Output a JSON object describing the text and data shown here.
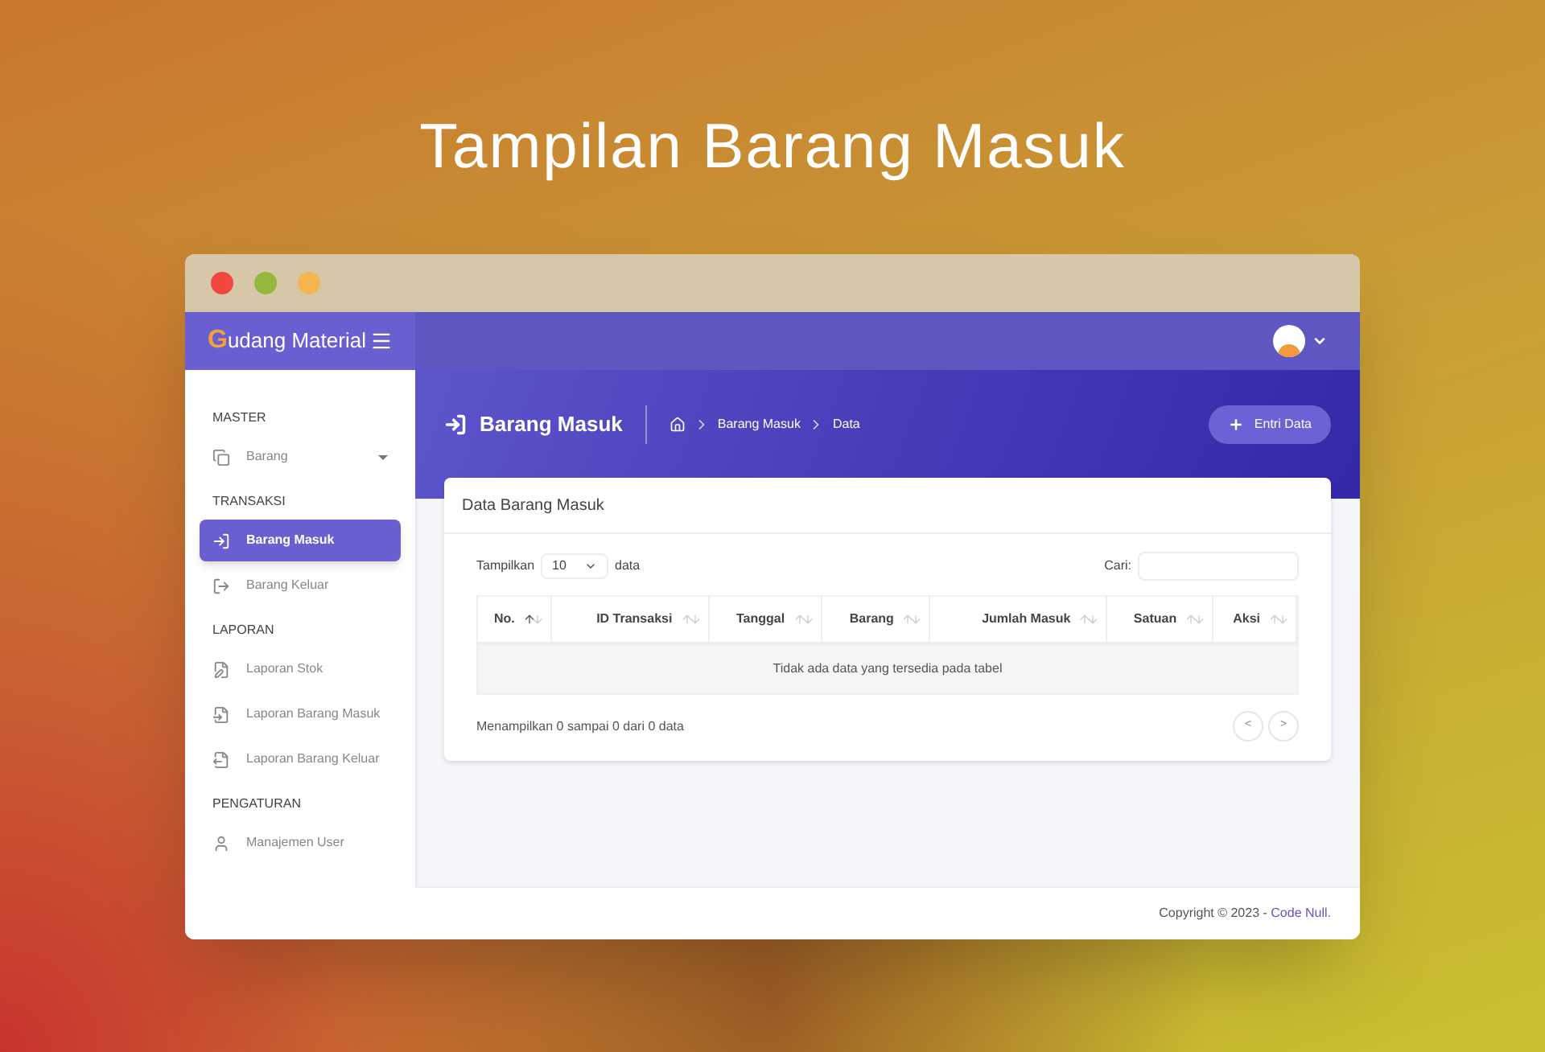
{
  "banner_title": "Tampilan Barang Masuk",
  "app": {
    "logo_letter": "G",
    "logo_rest": "udang Material"
  },
  "sidebar": {
    "sections": [
      {
        "heading": "MASTER",
        "items": [
          {
            "label": "Barang",
            "selected": false,
            "has_submenu": true
          }
        ]
      },
      {
        "heading": "TRANSAKSI",
        "items": [
          {
            "label": "Barang Masuk",
            "selected": true,
            "has_submenu": false
          },
          {
            "label": "Barang Keluar",
            "selected": false,
            "has_submenu": false
          }
        ]
      },
      {
        "heading": "LAPORAN",
        "items": [
          {
            "label": "Laporan Stok",
            "selected": false,
            "has_submenu": false
          },
          {
            "label": "Laporan Barang Masuk",
            "selected": false,
            "has_submenu": false
          },
          {
            "label": "Laporan Barang Keluar",
            "selected": false,
            "has_submenu": false
          }
        ]
      },
      {
        "heading": "PENGATURAN",
        "items": [
          {
            "label": "Manajemen User",
            "selected": false,
            "has_submenu": false
          }
        ]
      }
    ]
  },
  "page_header": {
    "title": "Barang Masuk",
    "breadcrumb": [
      "Barang Masuk",
      "Data"
    ],
    "button": "Entri Data"
  },
  "card": {
    "title": "Data Barang Masuk",
    "length_label": "Tampilkan",
    "length_value": "10",
    "length_suffix": "data",
    "search_label": "Cari:",
    "columns": [
      {
        "label": "No.",
        "sorted": true
      },
      {
        "label": "ID Transaksi",
        "sorted": false
      },
      {
        "label": "Tanggal",
        "sorted": false
      },
      {
        "label": "Barang",
        "sorted": false
      },
      {
        "label": "Jumlah Masuk",
        "sorted": false
      },
      {
        "label": "Satuan",
        "sorted": false
      },
      {
        "label": "Aksi",
        "sorted": false
      }
    ],
    "empty_message": "Tidak ada data yang tersedia pada tabel",
    "info": "Menampilkan 0 sampai 0 dari 0 data",
    "pagination": [
      "<",
      ">"
    ]
  },
  "footer": {
    "text": "Copyright © 2023 - ",
    "link": "Code Null."
  }
}
